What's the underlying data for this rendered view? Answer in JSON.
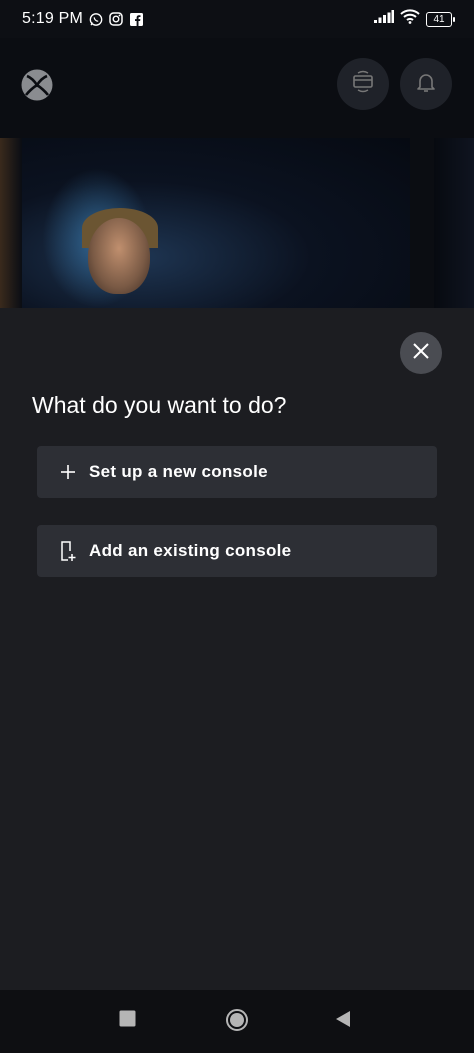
{
  "status_bar": {
    "time": "5:19 PM",
    "battery": "41",
    "icons": [
      "whatsapp-icon",
      "instagram-icon",
      "facebook-icon",
      "signal-icon",
      "wifi-icon",
      "battery-icon"
    ]
  },
  "background_app": {
    "icons": [
      "xbox-logo-icon",
      "remote-play-icon",
      "notifications-bell-icon"
    ]
  },
  "sheet": {
    "title": "What do you want to do?",
    "options": [
      {
        "label": "Set up a new console",
        "icon": "plus-icon"
      },
      {
        "label": "Add an existing console",
        "icon": "console-add-icon"
      }
    ],
    "close_icon": "close-icon"
  },
  "nav_bar": {
    "icons": [
      "recents-square-icon",
      "home-circle-icon",
      "back-triangle-icon"
    ]
  },
  "colors": {
    "sheet_bg": "#1c1d21",
    "option_bg": "#2d2f35",
    "close_bg": "#4a4c52",
    "text": "#ffffff"
  }
}
